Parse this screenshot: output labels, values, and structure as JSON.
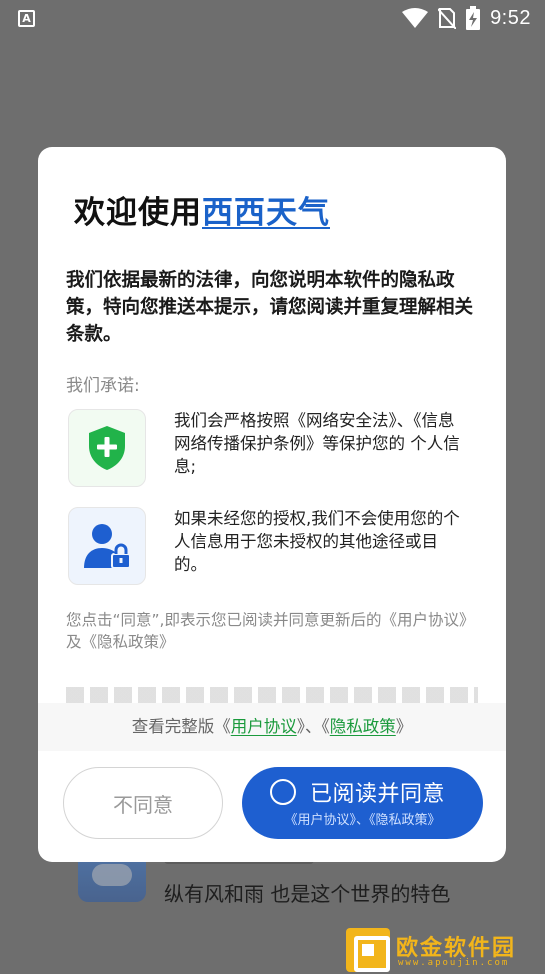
{
  "status_bar": {
    "app_icon_letter": "A",
    "time": "9:52",
    "icons": [
      "wifi-icon",
      "no-sim-icon",
      "battery-charging-icon"
    ]
  },
  "background": {
    "text": "纵有风和雨 也是这个世界的特色"
  },
  "dialog": {
    "title_prefix": "欢迎使用",
    "title_brand": "西西天气",
    "intro": "我们依据最新的法律，向您说明本软件的隐私政策，特向您推送本提示，请您阅读并重复理解相关条款。",
    "promise_label": "我们承诺:",
    "promises": [
      {
        "icon": "shield-plus-icon",
        "text": "我们会严格按照《网络安全法》、《信息网络传播保护条例》等保护您的 个人信息;"
      },
      {
        "icon": "user-lock-icon",
        "text": "如果未经您的授权,我们不会使用您的个人信息用于您未授权的其他途径或目的。"
      }
    ],
    "notice": "您点击“同意”,即表示您已阅读并同意更新后的《用户协议》及《隐私政策》",
    "full_link": {
      "prefix": "查看完整版《",
      "user_agreement": "用户协议",
      "middle": "》、《",
      "privacy_policy": "隐私政策",
      "suffix": "》"
    },
    "disagree_label": "不同意",
    "agree_label": "已阅读并同意",
    "agree_sub": "《用户协议》、《隐私政策》"
  },
  "watermark": {
    "text": "欧金软件园",
    "url": "www.apoujin.com"
  },
  "colors": {
    "brand_blue": "#1a62c9",
    "button_blue": "#1e5fd0",
    "link_green": "#1a9a3c",
    "shield_green": "#21b34a",
    "overlay": "#6e6e6e"
  }
}
